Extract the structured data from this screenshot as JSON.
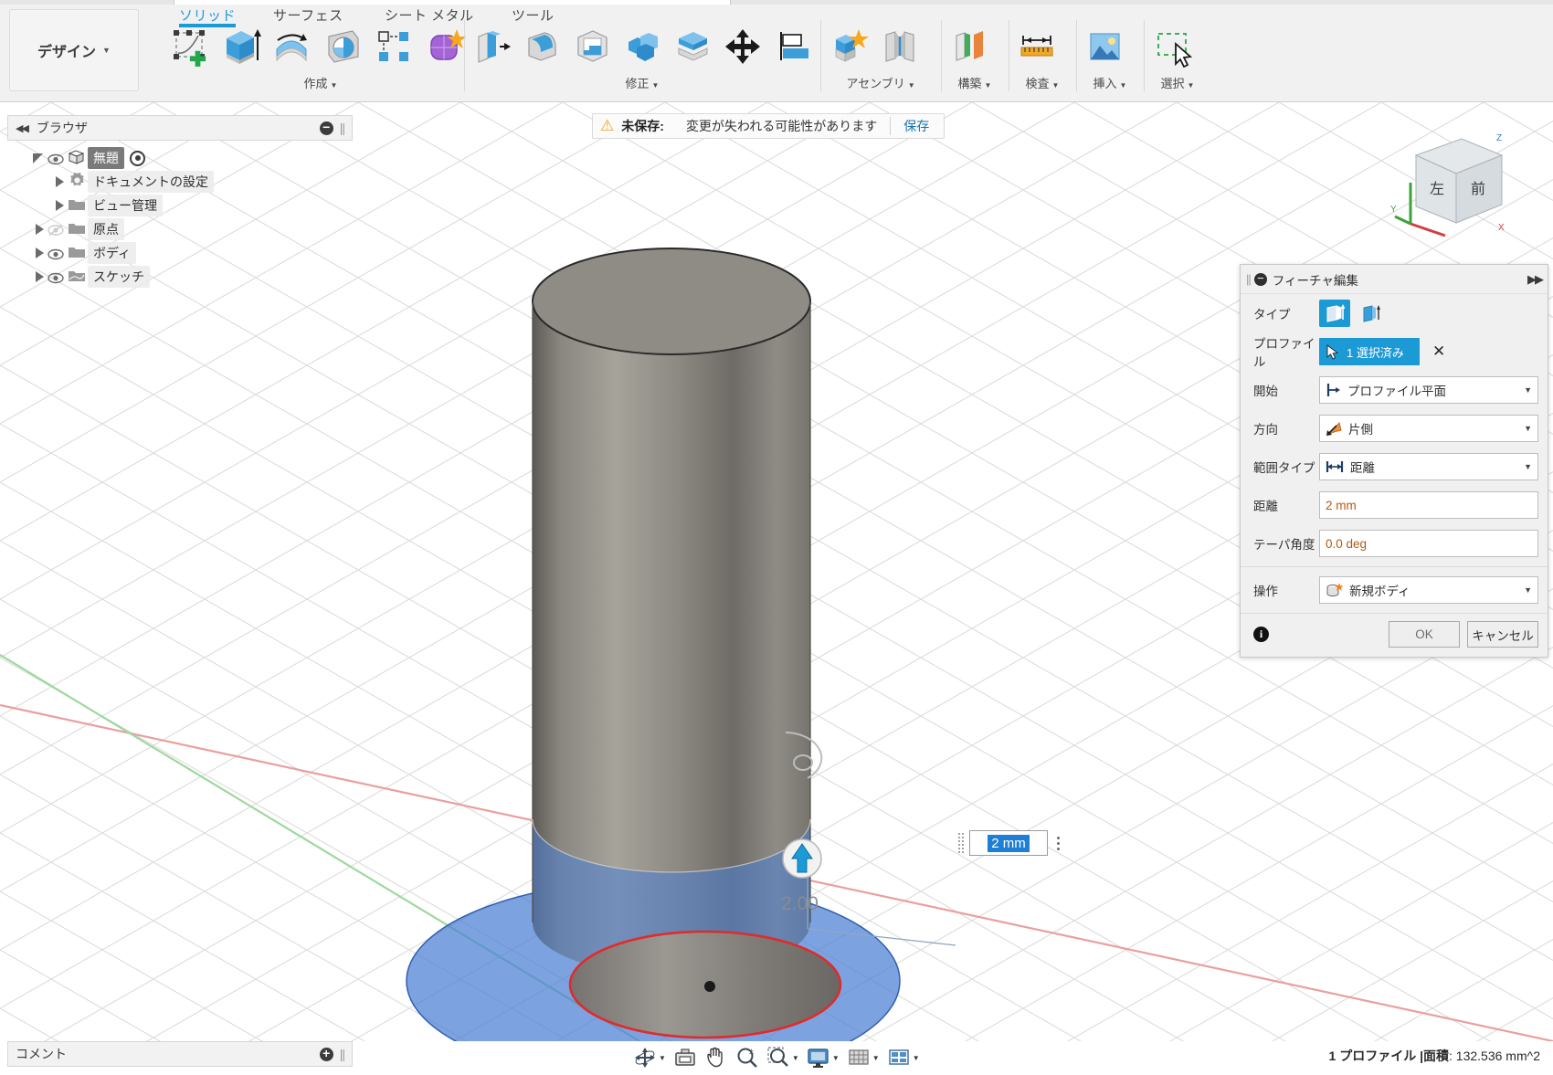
{
  "app": {
    "design_button": "デザイン",
    "caret": "▼"
  },
  "ribbon": {
    "tabs": [
      {
        "label": "ソリッド",
        "active": true
      },
      {
        "label": "サーフェス",
        "active": false
      },
      {
        "label": "シート メタル",
        "active": false
      },
      {
        "label": "ツール",
        "active": false
      }
    ],
    "groups": [
      {
        "label": "作成",
        "icons": [
          "create-sketch-icon",
          "extrude-icon",
          "revolve-icon",
          "sweep-icon",
          "pattern-icon",
          "form-icon"
        ]
      },
      {
        "label": "修正",
        "icons": [
          "press-pull-icon",
          "fillet-icon",
          "shell-icon",
          "combine-icon",
          "offset-face-icon",
          "move-copy-icon",
          "align-icon"
        ]
      },
      {
        "label": "アセンブリ",
        "icons": [
          "new-component-icon",
          "joint-icon"
        ]
      },
      {
        "label": "構築",
        "icons": [
          "offset-plane-icon"
        ]
      },
      {
        "label": "検査",
        "icons": [
          "measure-icon"
        ]
      },
      {
        "label": "挿入",
        "icons": [
          "insert-image-icon"
        ]
      },
      {
        "label": "選択",
        "icons": [
          "select-window-icon"
        ]
      }
    ]
  },
  "browser": {
    "title": "ブラウザ",
    "collapse_icon": "collapse-left-icon",
    "minus_icon": "minus-circle-icon",
    "tree": [
      {
        "label": "無題",
        "icon": "component-icon",
        "selected": true,
        "indent": 0,
        "eye": "visible",
        "radio": true,
        "triangle": "open"
      },
      {
        "label": "ドキュメントの設定",
        "icon": "gear-icon",
        "selected": false,
        "indent": 1,
        "eye": "none",
        "radio": false,
        "triangle": "closed"
      },
      {
        "label": "ビュー管理",
        "icon": "folder-icon",
        "selected": false,
        "indent": 1,
        "eye": "none",
        "radio": false,
        "triangle": "closed"
      },
      {
        "label": "原点",
        "icon": "folder-icon",
        "selected": false,
        "indent": 1,
        "eye": "hidden",
        "radio": false,
        "triangle": "closed"
      },
      {
        "label": "ボディ",
        "icon": "folder-icon",
        "selected": false,
        "indent": 1,
        "eye": "visible",
        "radio": false,
        "triangle": "closed"
      },
      {
        "label": "スケッチ",
        "icon": "folder-sketch-icon",
        "selected": false,
        "indent": 1,
        "eye": "visible",
        "radio": false,
        "triangle": "closed"
      }
    ]
  },
  "warning_bar": {
    "icon": "warning-triangle-icon",
    "title": "未保存:",
    "message": "変更が失われる可能性があります",
    "save_label": "保存"
  },
  "viewcube": {
    "front_face": "前",
    "left_face": "左",
    "axis_x": "X",
    "axis_y": "Y",
    "axis_z": "Z"
  },
  "dialog": {
    "title": "フィーチャ編集",
    "collapse_icon": "minus-circle-icon",
    "expand_icon": "expand-right-icon",
    "rows": {
      "type": {
        "label": "タイプ",
        "options": [
          "extrude-profile-icon",
          "extrude-edge-icon"
        ],
        "selected_index": 0
      },
      "profile": {
        "label": "プロファイル",
        "value": "1 選択済み",
        "cursor_icon": "cursor-arrow-icon",
        "clear_icon": "✕"
      },
      "start": {
        "label": "開始",
        "value": "プロファイル平面",
        "icon": "profile-plane-icon"
      },
      "direction": {
        "label": "方向",
        "value": "片側",
        "icon": "one-side-icon"
      },
      "extent_type": {
        "label": "範囲タイプ",
        "value": "距離",
        "icon": "distance-icon"
      },
      "distance": {
        "label": "距離",
        "value": "2 mm"
      },
      "taper_angle": {
        "label": "テーパ角度",
        "value": "0.0 deg"
      },
      "operation": {
        "label": "操作",
        "value": "新規ボディ",
        "icon": "new-body-icon"
      }
    },
    "footer": {
      "info_icon": "info-icon",
      "ok_label": "OK",
      "cancel_label": "キャンセル"
    }
  },
  "canvas": {
    "dimension_label": "2.00",
    "dimension_input": "2 mm",
    "arrow_icon": "extrude-arrow-up-icon"
  },
  "comment_bar": {
    "title": "コメント",
    "add_icon": "plus-circle-icon"
  },
  "navbar": {
    "buttons": [
      {
        "name": "orbit-icon",
        "caret": true
      },
      {
        "name": "look-at-icon",
        "caret": false
      },
      {
        "name": "pan-icon",
        "caret": false
      },
      {
        "name": "zoom-icon",
        "caret": false
      },
      {
        "name": "zoom-window-icon",
        "caret": true
      },
      {
        "name": "display-settings-icon",
        "caret": true
      },
      {
        "name": "grid-snap-icon",
        "caret": true
      },
      {
        "name": "viewports-icon",
        "caret": true
      }
    ]
  },
  "statusbar": {
    "profile_count": "1 プロファイル",
    "separator": "|",
    "area_label": "面積",
    "area_value": ": 132.536 mm^2"
  },
  "colors": {
    "accent_blue": "#1c9ad6",
    "warning_orange": "#f2a11c",
    "link_blue": "#1474b4",
    "value_orange": "#b05a10",
    "sketch_plane_blue": "#4a7fd4",
    "profile_red": "#e02b2b"
  }
}
